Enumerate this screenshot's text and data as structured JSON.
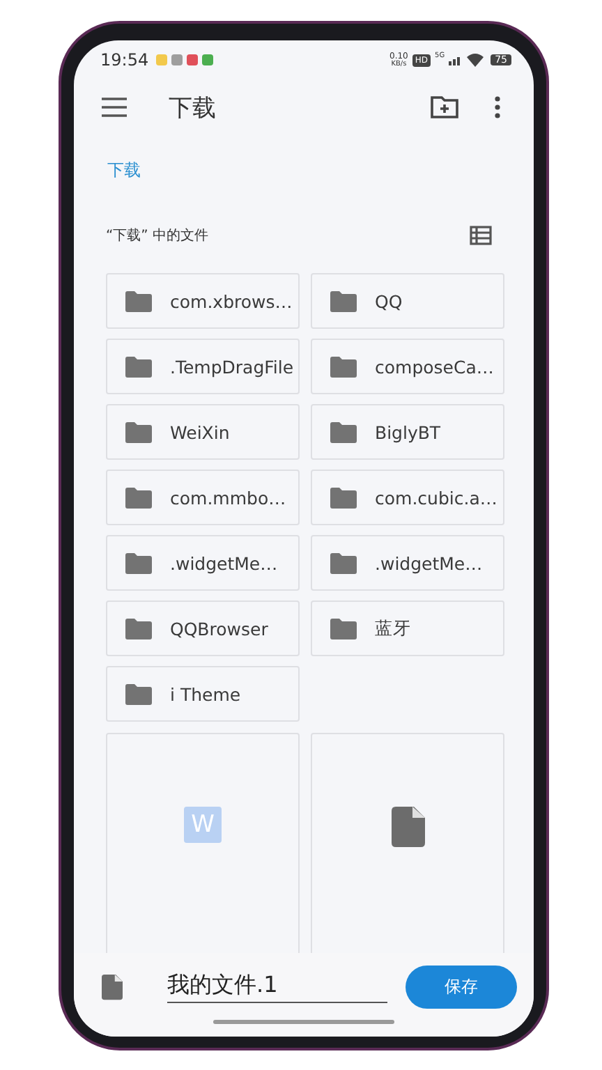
{
  "status_bar": {
    "time": "19:54",
    "notification_icons": [
      {
        "color": "#f2c94c"
      },
      {
        "color": "#9e9e9e"
      },
      {
        "color": "#e0505a"
      },
      {
        "color": "#4caf50"
      }
    ],
    "net_speed": "0.10",
    "net_unit": "KB/s",
    "hd": "HD",
    "network": "5G",
    "battery": "75"
  },
  "app_bar": {
    "title": "下载"
  },
  "breadcrumb": "下载",
  "section": {
    "title": "“下载” 中的文件"
  },
  "folders": [
    {
      "name": "com.xbrows…"
    },
    {
      "name": "QQ"
    },
    {
      "name": ".TempDragFile"
    },
    {
      "name": "composeCa…"
    },
    {
      "name": "WeiXin"
    },
    {
      "name": "BiglyBT"
    },
    {
      "name": "com.mmbo…"
    },
    {
      "name": "com.cubic.a…"
    },
    {
      "name": ".widgetMe…"
    },
    {
      "name": ".widgetMe…"
    },
    {
      "name": "QQBrowser"
    },
    {
      "name": "蓝牙"
    },
    {
      "name": "i Theme"
    }
  ],
  "documents": [
    {
      "kind": "word",
      "icon_text": "W"
    },
    {
      "kind": "file"
    }
  ],
  "save_bar": {
    "filename": "我的文件.1",
    "button": "保存"
  }
}
